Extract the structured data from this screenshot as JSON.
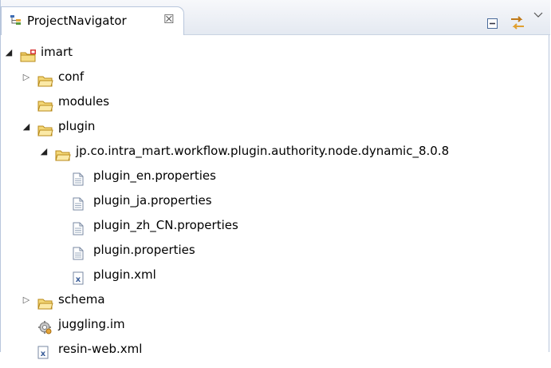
{
  "tab": {
    "title": "ProjectNavigator",
    "close_glyph": "☒",
    "icon": "tree-view-icon"
  },
  "toolbar": {
    "collapse_icon": "collapse-all-icon",
    "link_icon": "link-with-editor-icon",
    "menu_icon": "view-menu-icon"
  },
  "tree": [
    {
      "label": "imart",
      "depth": 0,
      "expander": "open",
      "icon": "project-icon"
    },
    {
      "label": "conf",
      "depth": 1,
      "expander": "closed",
      "icon": "folder-icon"
    },
    {
      "label": "modules",
      "depth": 1,
      "expander": "none",
      "icon": "folder-icon"
    },
    {
      "label": "plugin",
      "depth": 1,
      "expander": "open",
      "icon": "folder-icon"
    },
    {
      "label": "jp.co.intra_mart.workflow.plugin.authority.node.dynamic_8.0.8",
      "depth": 2,
      "expander": "open",
      "icon": "folder-icon"
    },
    {
      "label": "plugin_en.properties",
      "depth": 3,
      "expander": "none",
      "icon": "file-icon"
    },
    {
      "label": "plugin_ja.properties",
      "depth": 3,
      "expander": "none",
      "icon": "file-icon"
    },
    {
      "label": "plugin_zh_CN.properties",
      "depth": 3,
      "expander": "none",
      "icon": "file-icon"
    },
    {
      "label": "plugin.properties",
      "depth": 3,
      "expander": "none",
      "icon": "file-icon"
    },
    {
      "label": "plugin.xml",
      "depth": 3,
      "expander": "none",
      "icon": "xml-file-icon"
    },
    {
      "label": "schema",
      "depth": 1,
      "expander": "closed",
      "icon": "folder-icon"
    },
    {
      "label": "juggling.im",
      "depth": 1,
      "expander": "none",
      "icon": "juggling-icon"
    },
    {
      "label": "resin-web.xml",
      "depth": 1,
      "expander": "none",
      "icon": "xml-file-icon"
    }
  ]
}
